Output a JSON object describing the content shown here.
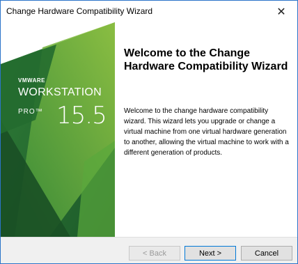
{
  "window": {
    "title": "Change Hardware Compatibility Wizard"
  },
  "banner": {
    "vendor": "VMWARE",
    "product": "WORKSTATION",
    "edition": "PRO™",
    "version": "15.5",
    "colors": {
      "dark": "#1f5b2e",
      "mid": "#3f8f3a",
      "light": "#8cc63f"
    }
  },
  "content": {
    "heading": "Welcome to the Change Hardware Compatibility Wizard",
    "body": "Welcome to the change hardware compatibility wizard. This wizard lets you upgrade or change a virtual machine from one virtual hardware generation to another, allowing the virtual machine to work with a different generation of products."
  },
  "footer": {
    "back_label": "< Back",
    "next_label": "Next >",
    "cancel_label": "Cancel"
  },
  "icons": {
    "close": "close-icon"
  }
}
